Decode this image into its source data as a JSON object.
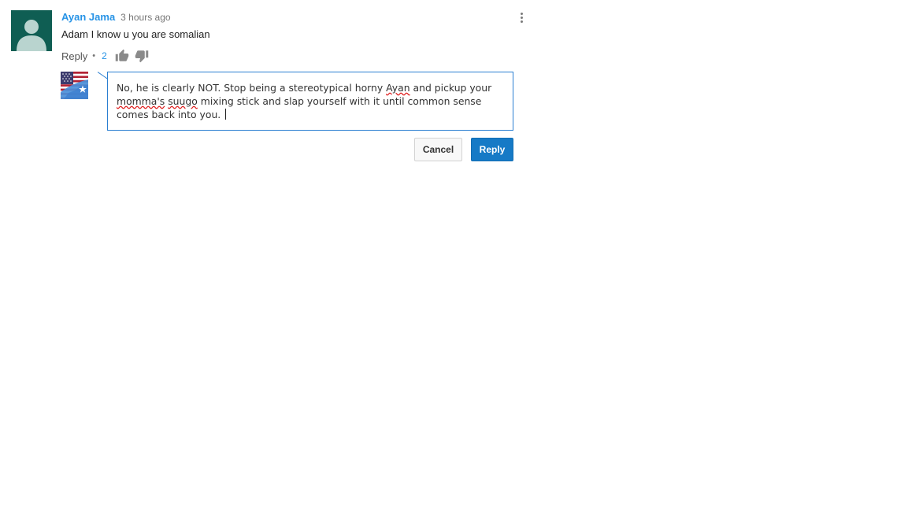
{
  "comment": {
    "author": "Ayan Jama",
    "timestamp": "3 hours ago",
    "text": "Adam I know u you are somalian",
    "reply_label": "Reply",
    "separator": "•",
    "like_count": "2",
    "icons": {
      "avatar": "default-user-avatar-icon",
      "like": "thumbs-up-icon",
      "dislike": "thumbs-down-icon",
      "menu": "more-vert-icon"
    }
  },
  "reply_box": {
    "lines": [
      "No, he is clearly NOT. Stop being a stereotypical horny Ayan and pickup your",
      "momma's suugo mixing stick and slap yourself with it until common sense",
      "comes back into you."
    ],
    "misspelled_words": [
      "Ayan",
      "momma's",
      "suugo"
    ],
    "cancel_label": "Cancel",
    "reply_label": "Reply",
    "user_avatar_icon": "us-somalia-flag-avatar"
  },
  "colors": {
    "author_link": "#2793e6",
    "avatar_bg": "#0f5e53",
    "input_border": "#2b7fd1",
    "primary_button": "#167ac6",
    "spellcheck_underline": "#e02020"
  }
}
